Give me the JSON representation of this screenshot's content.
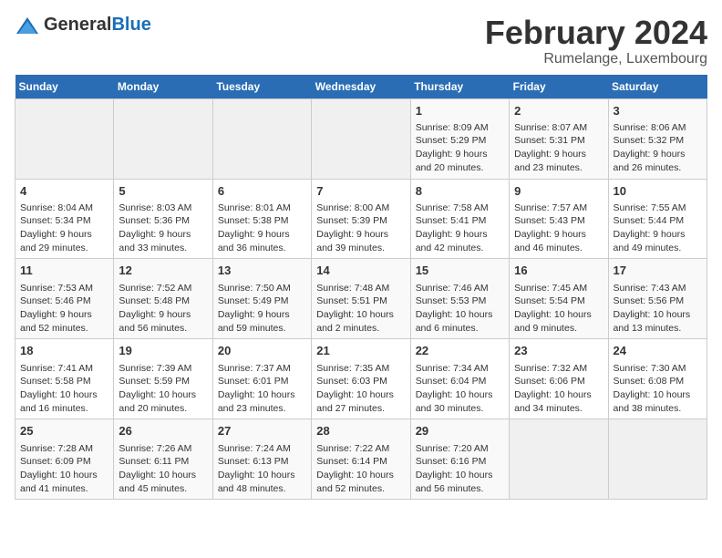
{
  "logo": {
    "text_general": "General",
    "text_blue": "Blue"
  },
  "title": "February 2024",
  "subtitle": "Rumelange, Luxembourg",
  "days_of_week": [
    "Sunday",
    "Monday",
    "Tuesday",
    "Wednesday",
    "Thursday",
    "Friday",
    "Saturday"
  ],
  "weeks": [
    [
      {
        "day": "",
        "info": ""
      },
      {
        "day": "",
        "info": ""
      },
      {
        "day": "",
        "info": ""
      },
      {
        "day": "",
        "info": ""
      },
      {
        "day": "1",
        "info": "Sunrise: 8:09 AM\nSunset: 5:29 PM\nDaylight: 9 hours and 20 minutes."
      },
      {
        "day": "2",
        "info": "Sunrise: 8:07 AM\nSunset: 5:31 PM\nDaylight: 9 hours and 23 minutes."
      },
      {
        "day": "3",
        "info": "Sunrise: 8:06 AM\nSunset: 5:32 PM\nDaylight: 9 hours and 26 minutes."
      }
    ],
    [
      {
        "day": "4",
        "info": "Sunrise: 8:04 AM\nSunset: 5:34 PM\nDaylight: 9 hours and 29 minutes."
      },
      {
        "day": "5",
        "info": "Sunrise: 8:03 AM\nSunset: 5:36 PM\nDaylight: 9 hours and 33 minutes."
      },
      {
        "day": "6",
        "info": "Sunrise: 8:01 AM\nSunset: 5:38 PM\nDaylight: 9 hours and 36 minutes."
      },
      {
        "day": "7",
        "info": "Sunrise: 8:00 AM\nSunset: 5:39 PM\nDaylight: 9 hours and 39 minutes."
      },
      {
        "day": "8",
        "info": "Sunrise: 7:58 AM\nSunset: 5:41 PM\nDaylight: 9 hours and 42 minutes."
      },
      {
        "day": "9",
        "info": "Sunrise: 7:57 AM\nSunset: 5:43 PM\nDaylight: 9 hours and 46 minutes."
      },
      {
        "day": "10",
        "info": "Sunrise: 7:55 AM\nSunset: 5:44 PM\nDaylight: 9 hours and 49 minutes."
      }
    ],
    [
      {
        "day": "11",
        "info": "Sunrise: 7:53 AM\nSunset: 5:46 PM\nDaylight: 9 hours and 52 minutes."
      },
      {
        "day": "12",
        "info": "Sunrise: 7:52 AM\nSunset: 5:48 PM\nDaylight: 9 hours and 56 minutes."
      },
      {
        "day": "13",
        "info": "Sunrise: 7:50 AM\nSunset: 5:49 PM\nDaylight: 9 hours and 59 minutes."
      },
      {
        "day": "14",
        "info": "Sunrise: 7:48 AM\nSunset: 5:51 PM\nDaylight: 10 hours and 2 minutes."
      },
      {
        "day": "15",
        "info": "Sunrise: 7:46 AM\nSunset: 5:53 PM\nDaylight: 10 hours and 6 minutes."
      },
      {
        "day": "16",
        "info": "Sunrise: 7:45 AM\nSunset: 5:54 PM\nDaylight: 10 hours and 9 minutes."
      },
      {
        "day": "17",
        "info": "Sunrise: 7:43 AM\nSunset: 5:56 PM\nDaylight: 10 hours and 13 minutes."
      }
    ],
    [
      {
        "day": "18",
        "info": "Sunrise: 7:41 AM\nSunset: 5:58 PM\nDaylight: 10 hours and 16 minutes."
      },
      {
        "day": "19",
        "info": "Sunrise: 7:39 AM\nSunset: 5:59 PM\nDaylight: 10 hours and 20 minutes."
      },
      {
        "day": "20",
        "info": "Sunrise: 7:37 AM\nSunset: 6:01 PM\nDaylight: 10 hours and 23 minutes."
      },
      {
        "day": "21",
        "info": "Sunrise: 7:35 AM\nSunset: 6:03 PM\nDaylight: 10 hours and 27 minutes."
      },
      {
        "day": "22",
        "info": "Sunrise: 7:34 AM\nSunset: 6:04 PM\nDaylight: 10 hours and 30 minutes."
      },
      {
        "day": "23",
        "info": "Sunrise: 7:32 AM\nSunset: 6:06 PM\nDaylight: 10 hours and 34 minutes."
      },
      {
        "day": "24",
        "info": "Sunrise: 7:30 AM\nSunset: 6:08 PM\nDaylight: 10 hours and 38 minutes."
      }
    ],
    [
      {
        "day": "25",
        "info": "Sunrise: 7:28 AM\nSunset: 6:09 PM\nDaylight: 10 hours and 41 minutes."
      },
      {
        "day": "26",
        "info": "Sunrise: 7:26 AM\nSunset: 6:11 PM\nDaylight: 10 hours and 45 minutes."
      },
      {
        "day": "27",
        "info": "Sunrise: 7:24 AM\nSunset: 6:13 PM\nDaylight: 10 hours and 48 minutes."
      },
      {
        "day": "28",
        "info": "Sunrise: 7:22 AM\nSunset: 6:14 PM\nDaylight: 10 hours and 52 minutes."
      },
      {
        "day": "29",
        "info": "Sunrise: 7:20 AM\nSunset: 6:16 PM\nDaylight: 10 hours and 56 minutes."
      },
      {
        "day": "",
        "info": ""
      },
      {
        "day": "",
        "info": ""
      }
    ]
  ]
}
